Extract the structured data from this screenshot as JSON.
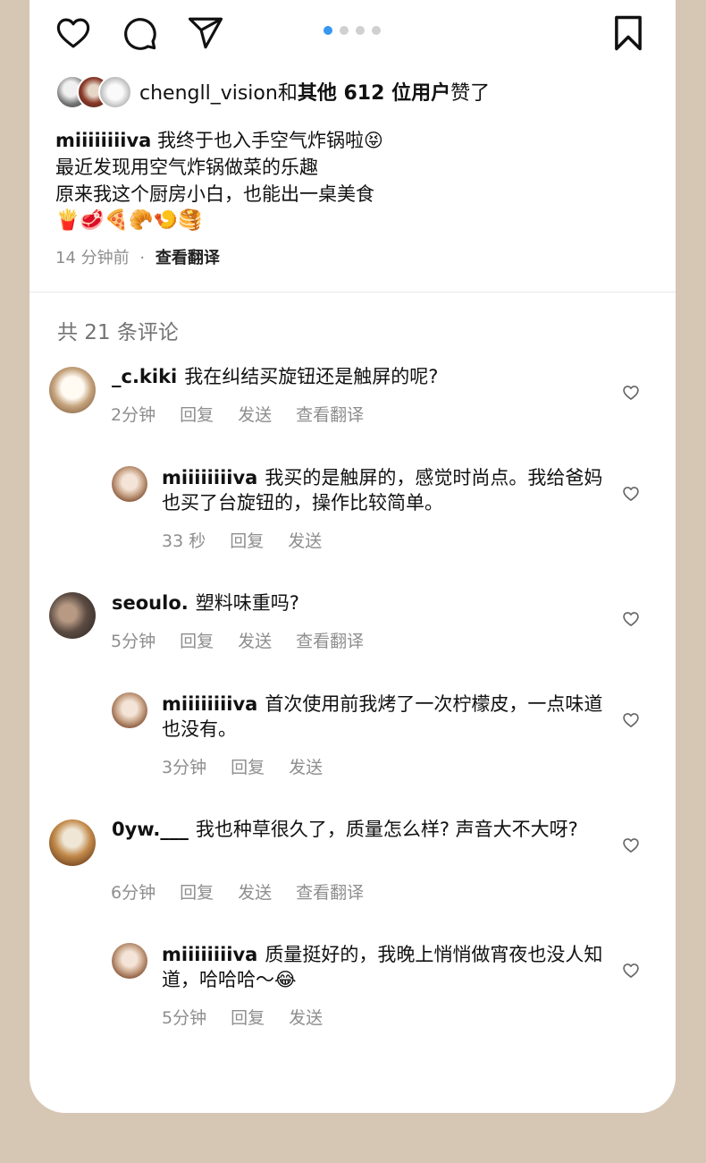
{
  "carousel": {
    "count": 4,
    "active_index": 0
  },
  "likes": {
    "username": "chengll_vision",
    "connector": "和",
    "others": "其他 612 位用户",
    "suffix": "赞了"
  },
  "caption": {
    "username": "miiiiiiiiva",
    "line1": "我终于也入手空气炸锅啦😝",
    "line2": "最近发现用空气炸锅做菜的乐趣",
    "line3": "原来我这个厨房小白，也能出一桌美食",
    "emojis": "🍟🥩🍕🥐🍤🥞"
  },
  "meta": {
    "time": "14 分钟前",
    "sep": "·",
    "translate": "查看翻译"
  },
  "comments_count": "共 21 条评论",
  "comments": [
    {
      "user": "_c.kiki",
      "text": "我在纠结买旋钮还是触屏的呢?",
      "time": "2分钟",
      "reply": "回复",
      "send": "发送",
      "translate": "查看翻译"
    },
    {
      "user": "miiiiiiiiva",
      "text": "我买的是触屏的，感觉时尚点。我给爸妈也买了台旋钮的，操作比较简单。",
      "time": "33 秒",
      "reply": "回复",
      "send": "发送"
    },
    {
      "user": "seoulo.",
      "text": "塑料味重吗?",
      "time": "5分钟",
      "reply": "回复",
      "send": "发送",
      "translate": "查看翻译"
    },
    {
      "user": "miiiiiiiiva",
      "text": "首次使用前我烤了一次柠檬皮，一点味道也没有。",
      "time": "3分钟",
      "reply": "回复",
      "send": "发送"
    },
    {
      "user": "0yw.___",
      "text": "我也种草很久了，质量怎么样? 声音大不大呀?",
      "time": "6分钟",
      "reply": "回复",
      "send": "发送",
      "translate": "查看翻译"
    },
    {
      "user": "miiiiiiiiva",
      "text": "质量挺好的，我晚上悄悄做宵夜也没人知道，哈哈哈～😂",
      "time": "5分钟",
      "reply": "回复",
      "send": "发送"
    }
  ]
}
